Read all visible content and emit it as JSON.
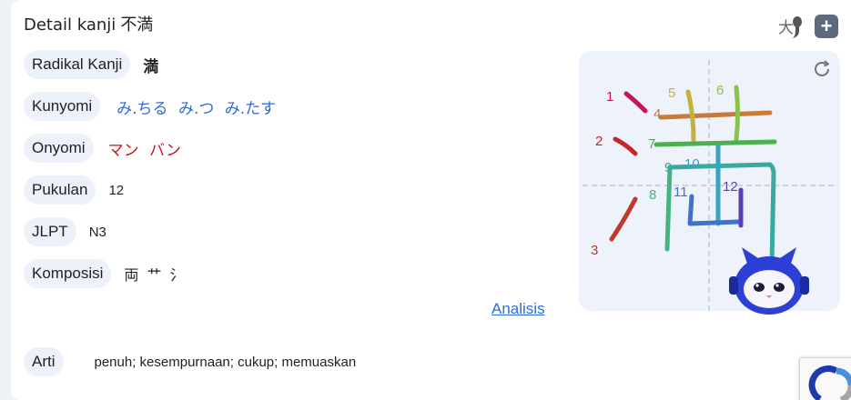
{
  "header": {
    "title_prefix": "Detail kanji",
    "kanji": "不満"
  },
  "details": {
    "radical": {
      "label": "Radikal Kanji",
      "value": "満"
    },
    "kunyomi": {
      "label": "Kunyomi",
      "value": "み.ちる み.つ み.たす"
    },
    "onyomi": {
      "label": "Onyomi",
      "value": "マン バン"
    },
    "strokes": {
      "label": "Pukulan",
      "value": "12"
    },
    "jlpt": {
      "label": "JLPT",
      "value": "N3"
    },
    "composition": {
      "label": "Komposisi",
      "value": "両 艹 氵"
    },
    "meaning": {
      "label": "Arti",
      "value": "penuh; kesempurnaan; cukup; memuaskan"
    }
  },
  "analysis_link": "Analisis",
  "toolbar": {
    "toggle_glyph": "大",
    "add_label": "+"
  },
  "stroke_order": {
    "numbers": [
      "1",
      "2",
      "3",
      "4",
      "5",
      "6",
      "7",
      "8",
      "9",
      "10",
      "11",
      "12"
    ],
    "colors": [
      "#c2185b",
      "#c62828",
      "#c0392b",
      "#c77a3a",
      "#c4b23a",
      "#8bc34a",
      "#4caf50",
      "#43b581",
      "#3aa9a0",
      "#35a3c2",
      "#3f72c9",
      "#5a3fb5"
    ]
  },
  "icons": {
    "replay": "replay-icon",
    "mascot": "robot-mascot",
    "recaptcha": "recaptcha-icon"
  }
}
